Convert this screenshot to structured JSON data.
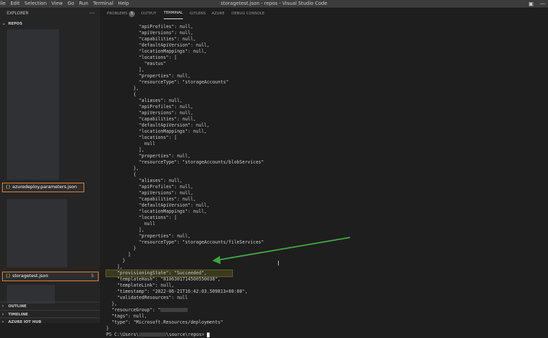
{
  "menu": [
    "ile",
    "Edit",
    "Selection",
    "View",
    "Go",
    "Run",
    "Terminal",
    "Help"
  ],
  "window_title": "storagetest.json - repos - Visual Studio Code",
  "sidebar": {
    "explorer_label": "EXPLORER",
    "more": "···",
    "repos_label": "REPOS",
    "files": [
      {
        "name": "azuredeploy.parameters.json",
        "icon": "{}",
        "badge": ""
      },
      {
        "name": "storagetest.json",
        "icon": "{}",
        "badge": "5"
      }
    ],
    "outline_label": "OUTLINE",
    "timeline_label": "TIMELINE",
    "azure_iot_label": "AZURE IOT HUB"
  },
  "panel_tabs": {
    "problems": "PROBLEMS",
    "problems_count": "5",
    "output": "OUTPUT",
    "terminal": "TERMINAL",
    "gitlens": "GITLENS",
    "azure": "AZURE",
    "debug_console": "DEBUG CONSOLE"
  },
  "terminal_lines": [
    "            \"apiProfiles\": null,",
    "            \"apiVersions\": null,",
    "            \"capabilities\": null,",
    "            \"defaultApiVersion\": null,",
    "            \"locationMappings\": null,",
    "            \"locations\": [",
    "              \"eastus\"",
    "            ],",
    "            \"properties\": null,",
    "            \"resourceType\": \"storageAccounts\"",
    "          },",
    "          {",
    "            \"aliases\": null,",
    "            \"apiProfiles\": null,",
    "            \"apiVersions\": null,",
    "            \"capabilities\": null,",
    "            \"defaultApiVersion\": null,",
    "            \"locationMappings\": null,",
    "            \"locations\": [",
    "              null",
    "            ],",
    "            \"properties\": null,",
    "            \"resourceType\": \"storageAccounts/blobServices\"",
    "          },",
    "          {",
    "            \"aliases\": null,",
    "            \"apiProfiles\": null,",
    "            \"apiVersions\": null,",
    "            \"capabilities\": null,",
    "            \"defaultApiVersion\": null,",
    "            \"locationMappings\": null,",
    "            \"locations\": [",
    "              null",
    "            ],",
    "            \"properties\": null,",
    "            \"resourceType\": \"storageAccounts/fileServices\"",
    "          }",
    "        ]",
    "      }",
    "    ],",
    "    \"provisioningState\": \"Succeeded\",",
    "    \"templateHash\": \"8106301714500550038\",",
    "    \"templateLink\": null,",
    "    \"timestamp\": \"2022-06-21T16:42:03.509813+00:00\",",
    "    \"validatedResources\": null",
    "  },",
    "  \"resourceGroup\": \"",
    "  \"tags\": null,",
    "  \"type\": \"Microsoft.Resources/deployments\"",
    "}",
    "PS C:\\Users\\"
  ],
  "prompt_tail": "\\source\\repos> ",
  "colors": {
    "highlight_border": "#e8842a",
    "arrow": "#3fa33f"
  }
}
